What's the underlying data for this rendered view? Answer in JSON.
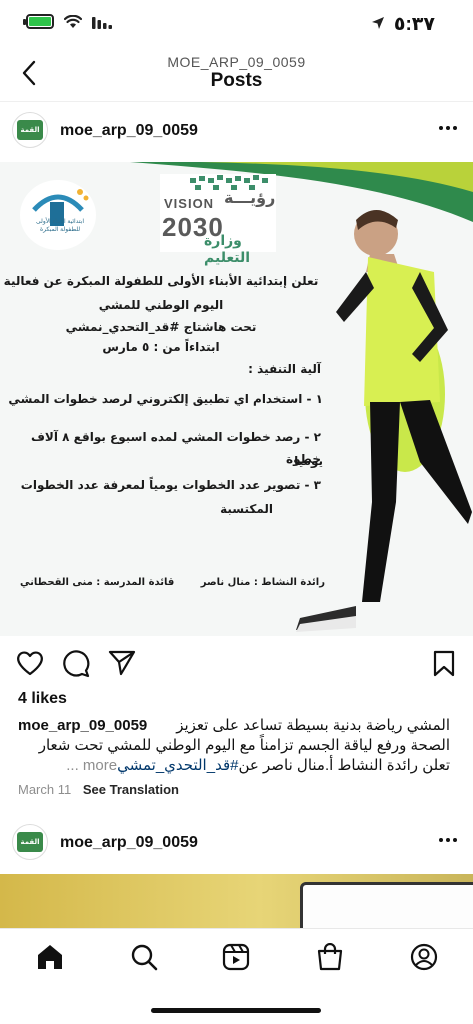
{
  "status_bar": {
    "time": "٥:٣٧",
    "battery_color": "#2ec44a",
    "icons": [
      "battery-charging-icon",
      "wifi-icon",
      "cellular-signal-icon",
      "location-arrow-icon"
    ]
  },
  "header": {
    "subtitle": "MOE_ARP_09_0059",
    "title": "Posts",
    "back_icon": "chevron-left-icon"
  },
  "post": {
    "username": "moe_arp_09_0059",
    "avatar_text": "القمة",
    "poster": {
      "vision_word": "VISION",
      "vision_arabic": "رؤيـــة",
      "vision_year": "2030",
      "ministry": "وزارة التعليم",
      "school_caption": "ابتدائية الأبناء الأولى للطفولة المبكرة",
      "line1": "تعلن إبتدائية الأبناء الأولى للطفولة المبكرة عن فعالية",
      "line2": "اليوم الوطني للمشي",
      "line3": "تحت هاشتاج #قد_التحدي_نمشي",
      "line4": "ابتداءاً من : ٥ مارس",
      "mechanism_title": "آلية التنفيذ :",
      "step1": "١ - استخدام اي تطبيق إلكتروني لرصد خطوات المشي",
      "step2": "٢ - رصد خطوات المشي لمده اسبوع بواقع ٨ آلاف خطوة",
      "step2b": "يوميا",
      "step3": "٣ - تصوير عدد الخطوات يومياً لمعرفة عدد الخطوات",
      "step3b": "المكتسبة",
      "activity_leader": "رائدة النشاط : منال ناصر",
      "principal": "قائدة المدرسة : منى القحطاني"
    },
    "likes": "4 likes",
    "caption_user": "moe_arp_09_0059",
    "caption_text_1": "المشي رياضة بدنية بسيطة تساعد على تعزيز",
    "caption_text_2": "الصحة ورفع لياقة الجسم تزامناً مع اليوم الوطني للمشي تحت شعار",
    "caption_hashtag": "#قد_التحدي_تمشي",
    "caption_text_3": " تعلن رائدة النشاط أ.منال ناصر عن",
    "caption_more": "... more",
    "date": "March 11",
    "see_translation": "See Translation"
  },
  "post2": {
    "username": "moe_arp_09_0059",
    "avatar_text": "القمة"
  },
  "tab_bar": {
    "tabs": [
      "home-icon",
      "search-icon",
      "reels-icon",
      "shop-icon",
      "profile-icon"
    ]
  }
}
